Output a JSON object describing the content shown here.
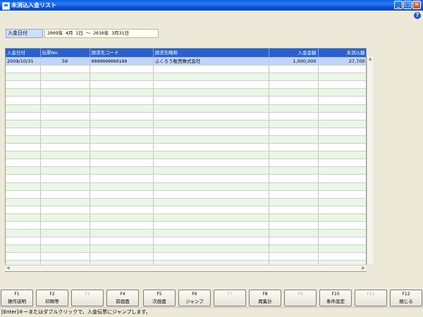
{
  "window": {
    "title": "未消込入金リスト",
    "help": "?",
    "min": "_",
    "max": "□",
    "close": "✕"
  },
  "filter": {
    "label": "入金日付",
    "value": "2009年 4月 1日 ～ 2010年 3月31日"
  },
  "grid": {
    "columns": [
      "入金日付",
      "伝票No.",
      "請求先コード",
      "請求先略称",
      "入金金額",
      "未消込額"
    ],
    "rows": [
      [
        "2009/10/31",
        "59",
        "0000000000100",
        "ふくろう販売株式会社",
        "1,000,000",
        "27,700"
      ]
    ]
  },
  "fkeys": [
    {
      "key": "F1",
      "label": "操作説明",
      "enabled": true
    },
    {
      "key": "F2",
      "label": "印刷等",
      "enabled": true
    },
    {
      "key": "F3",
      "label": "",
      "enabled": false
    },
    {
      "key": "F4",
      "label": "前画面",
      "enabled": true
    },
    {
      "key": "F5",
      "label": "次画面",
      "enabled": true
    },
    {
      "key": "F6",
      "label": "ジャンプ",
      "enabled": true
    },
    {
      "key": "F7",
      "label": "",
      "enabled": false
    },
    {
      "key": "F8",
      "label": "再集計",
      "enabled": true
    },
    {
      "key": "F9",
      "label": "",
      "enabled": false
    },
    {
      "key": "F10",
      "label": "条件設定",
      "enabled": true
    },
    {
      "key": "F11",
      "label": "",
      "enabled": false
    },
    {
      "key": "F12",
      "label": "閉じる",
      "enabled": true
    }
  ],
  "status": "[Enter]キーまたはダブルクリックで、入金伝票にジャンプします。"
}
